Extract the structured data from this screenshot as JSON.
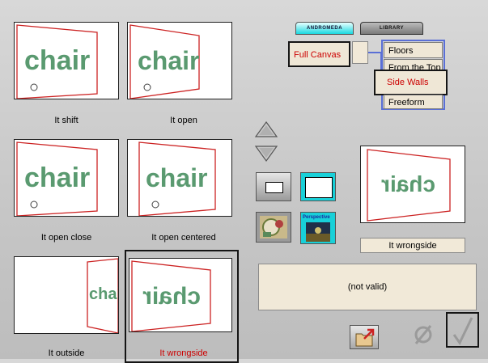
{
  "tabs": {
    "andromeda": "ANDROMEDA",
    "library": "LIBRARY"
  },
  "canvas_mode": "Full Canvas",
  "modes": [
    "Floors",
    "From the Top",
    "Side Walls",
    "Freeform"
  ],
  "thumbnails": [
    {
      "caption": "It shift",
      "word": "chair"
    },
    {
      "caption": "It open",
      "word": "chair"
    },
    {
      "caption": "It open close",
      "word": "chair"
    },
    {
      "caption": "It open centered",
      "word": "chair"
    },
    {
      "caption": "It outside",
      "word": "chair"
    },
    {
      "caption": "It wrongside",
      "word": "chair"
    }
  ],
  "preview": {
    "caption": "It wrongside"
  },
  "status_text": "(not valid)",
  "perspective_label": "Perspective",
  "colors": {
    "accent_red": "#cc0000",
    "selection_border": "#151515",
    "mode_list_border": "#5a6fd6",
    "panel_bg": "#f1e9d8",
    "tab_cyan": "#18d8e0"
  }
}
